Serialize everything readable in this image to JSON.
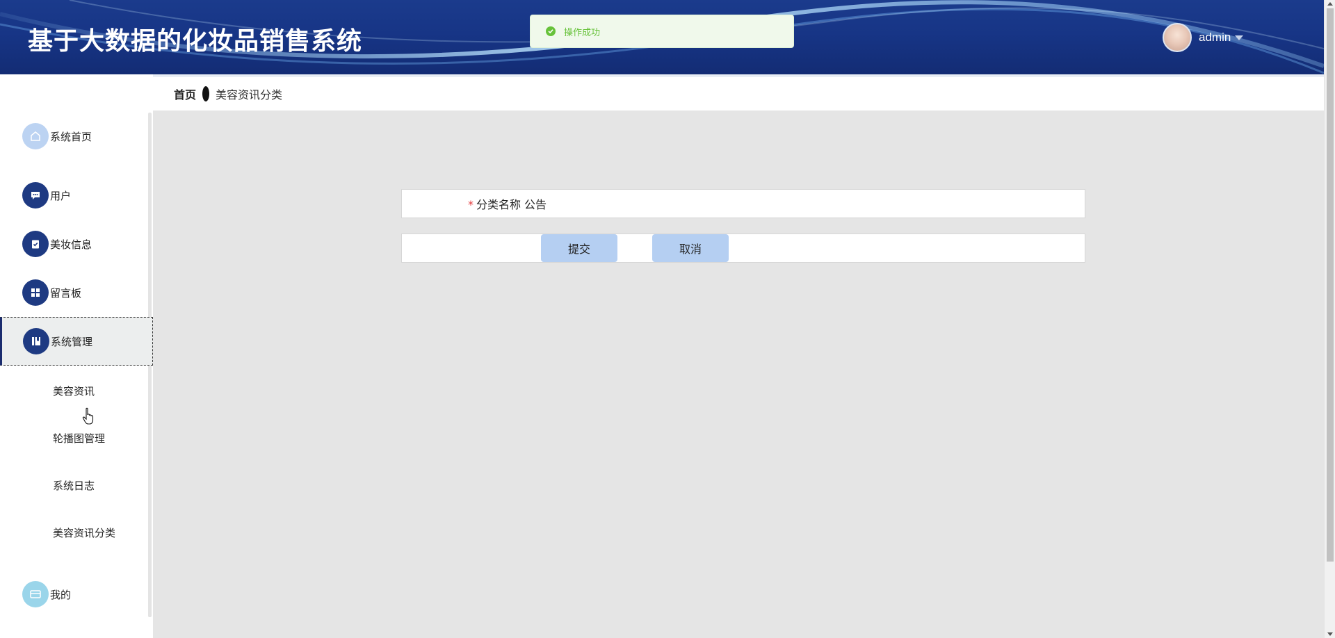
{
  "header": {
    "title": "基于大数据的化妆品销售系统",
    "username": "admin",
    "bg_color": "#173586"
  },
  "toast": {
    "message": "操作成功",
    "type": "success",
    "color": "#67c23a"
  },
  "breadcrumb": {
    "home": "首页",
    "current": "美容资讯分类"
  },
  "sidebar": {
    "items": [
      {
        "label": "系统首页",
        "icon": "home-icon"
      },
      {
        "label": "用户",
        "icon": "chat-icon"
      },
      {
        "label": "美妆信息",
        "icon": "clipboard-icon"
      },
      {
        "label": "留言板",
        "icon": "grid-icon"
      },
      {
        "label": "系统管理",
        "icon": "book-icon",
        "active": true
      },
      {
        "label": "我的",
        "icon": "wallet-icon"
      }
    ],
    "sub_items": [
      "美容资讯",
      "轮播图管理",
      "系统日志",
      "美容资讯分类"
    ]
  },
  "form": {
    "category_label": "分类名称",
    "required_mark": "*",
    "category_value": "公告",
    "submit_label": "提交",
    "cancel_label": "取消",
    "button_color": "#b5cff2"
  }
}
